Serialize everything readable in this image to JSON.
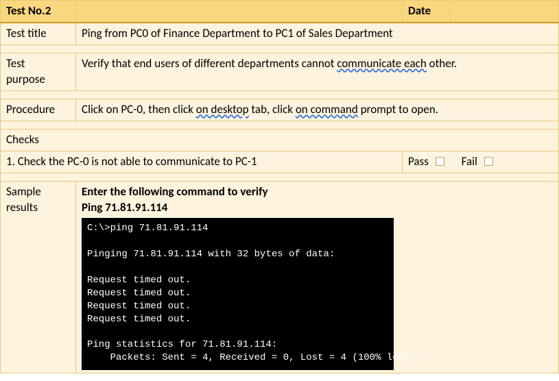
{
  "header": {
    "test_no_label": "Test No.2",
    "test_no_value": "",
    "date_label": "Date",
    "date_value": ""
  },
  "rows": {
    "title_label": "Test title",
    "title_value_a": "Ping from PC0 of Finance Department to PC1 of Sales Department",
    "purpose_label_1": "Test",
    "purpose_label_2": "purpose",
    "purpose_a": "Verify that end users of different departments cannot ",
    "purpose_b": "communicate each",
    "purpose_c": " other.",
    "procedure_label": "Procedure",
    "procedure_a": "Click on PC-0, then click ",
    "procedure_b": "on desktop",
    "procedure_c": " tab, click ",
    "procedure_d": "on command",
    "procedure_e": " prompt to open.",
    "checks_label": "Checks",
    "check_item": "1.  Check the PC-0 is not able to communicate to PC-1",
    "pass_label": "Pass",
    "fail_label": "Fail",
    "sample_label_1": "Sample",
    "sample_label_2": "results",
    "sample_h1": "Enter the following command to verify",
    "sample_h2": "Ping 71.81.91.114"
  },
  "terminal": {
    "l1": "C:\\>ping 71.81.91.114",
    "l2": "",
    "l3": "Pinging 71.81.91.114 with 32 bytes of data:",
    "l4": "",
    "l5": "Request timed out.",
    "l6": "Request timed out.",
    "l7": "Request timed out.",
    "l8": "Request timed out.",
    "l9": "",
    "l10": "Ping statistics for 71.81.91.114:",
    "l11": "    Packets: Sent = 4, Received = 0, Lost = 4 (100% loss),"
  }
}
